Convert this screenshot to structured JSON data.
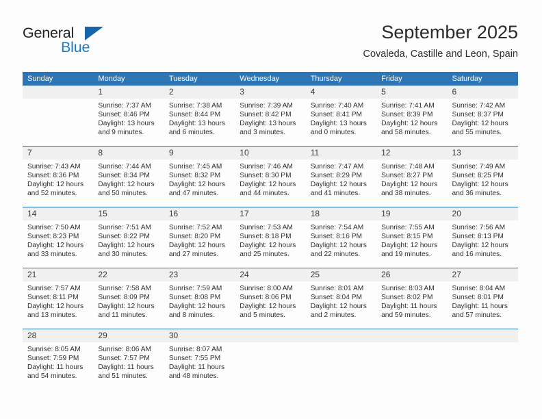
{
  "brand": {
    "name_part1": "General",
    "name_part2": "Blue",
    "logo_icon": "blue-triangle-logo",
    "accent_color": "#1a7bc4",
    "header_color": "#2e75b6"
  },
  "header": {
    "title": "September 2025",
    "subtitle": "Covaleda, Castille and Leon, Spain"
  },
  "calendar": {
    "weekdays": [
      "Sunday",
      "Monday",
      "Tuesday",
      "Wednesday",
      "Thursday",
      "Friday",
      "Saturday"
    ],
    "weeks": [
      [
        {
          "day": "",
          "empty": true
        },
        {
          "day": "1",
          "sunrise": "Sunrise: 7:37 AM",
          "sunset": "Sunset: 8:46 PM",
          "daylight1": "Daylight: 13 hours",
          "daylight2": "and 9 minutes."
        },
        {
          "day": "2",
          "sunrise": "Sunrise: 7:38 AM",
          "sunset": "Sunset: 8:44 PM",
          "daylight1": "Daylight: 13 hours",
          "daylight2": "and 6 minutes."
        },
        {
          "day": "3",
          "sunrise": "Sunrise: 7:39 AM",
          "sunset": "Sunset: 8:42 PM",
          "daylight1": "Daylight: 13 hours",
          "daylight2": "and 3 minutes."
        },
        {
          "day": "4",
          "sunrise": "Sunrise: 7:40 AM",
          "sunset": "Sunset: 8:41 PM",
          "daylight1": "Daylight: 13 hours",
          "daylight2": "and 0 minutes."
        },
        {
          "day": "5",
          "sunrise": "Sunrise: 7:41 AM",
          "sunset": "Sunset: 8:39 PM",
          "daylight1": "Daylight: 12 hours",
          "daylight2": "and 58 minutes."
        },
        {
          "day": "6",
          "sunrise": "Sunrise: 7:42 AM",
          "sunset": "Sunset: 8:37 PM",
          "daylight1": "Daylight: 12 hours",
          "daylight2": "and 55 minutes."
        }
      ],
      [
        {
          "day": "7",
          "sunrise": "Sunrise: 7:43 AM",
          "sunset": "Sunset: 8:36 PM",
          "daylight1": "Daylight: 12 hours",
          "daylight2": "and 52 minutes."
        },
        {
          "day": "8",
          "sunrise": "Sunrise: 7:44 AM",
          "sunset": "Sunset: 8:34 PM",
          "daylight1": "Daylight: 12 hours",
          "daylight2": "and 50 minutes."
        },
        {
          "day": "9",
          "sunrise": "Sunrise: 7:45 AM",
          "sunset": "Sunset: 8:32 PM",
          "daylight1": "Daylight: 12 hours",
          "daylight2": "and 47 minutes."
        },
        {
          "day": "10",
          "sunrise": "Sunrise: 7:46 AM",
          "sunset": "Sunset: 8:30 PM",
          "daylight1": "Daylight: 12 hours",
          "daylight2": "and 44 minutes."
        },
        {
          "day": "11",
          "sunrise": "Sunrise: 7:47 AM",
          "sunset": "Sunset: 8:29 PM",
          "daylight1": "Daylight: 12 hours",
          "daylight2": "and 41 minutes."
        },
        {
          "day": "12",
          "sunrise": "Sunrise: 7:48 AM",
          "sunset": "Sunset: 8:27 PM",
          "daylight1": "Daylight: 12 hours",
          "daylight2": "and 38 minutes."
        },
        {
          "day": "13",
          "sunrise": "Sunrise: 7:49 AM",
          "sunset": "Sunset: 8:25 PM",
          "daylight1": "Daylight: 12 hours",
          "daylight2": "and 36 minutes."
        }
      ],
      [
        {
          "day": "14",
          "sunrise": "Sunrise: 7:50 AM",
          "sunset": "Sunset: 8:23 PM",
          "daylight1": "Daylight: 12 hours",
          "daylight2": "and 33 minutes."
        },
        {
          "day": "15",
          "sunrise": "Sunrise: 7:51 AM",
          "sunset": "Sunset: 8:22 PM",
          "daylight1": "Daylight: 12 hours",
          "daylight2": "and 30 minutes."
        },
        {
          "day": "16",
          "sunrise": "Sunrise: 7:52 AM",
          "sunset": "Sunset: 8:20 PM",
          "daylight1": "Daylight: 12 hours",
          "daylight2": "and 27 minutes."
        },
        {
          "day": "17",
          "sunrise": "Sunrise: 7:53 AM",
          "sunset": "Sunset: 8:18 PM",
          "daylight1": "Daylight: 12 hours",
          "daylight2": "and 25 minutes."
        },
        {
          "day": "18",
          "sunrise": "Sunrise: 7:54 AM",
          "sunset": "Sunset: 8:16 PM",
          "daylight1": "Daylight: 12 hours",
          "daylight2": "and 22 minutes."
        },
        {
          "day": "19",
          "sunrise": "Sunrise: 7:55 AM",
          "sunset": "Sunset: 8:15 PM",
          "daylight1": "Daylight: 12 hours",
          "daylight2": "and 19 minutes."
        },
        {
          "day": "20",
          "sunrise": "Sunrise: 7:56 AM",
          "sunset": "Sunset: 8:13 PM",
          "daylight1": "Daylight: 12 hours",
          "daylight2": "and 16 minutes."
        }
      ],
      [
        {
          "day": "21",
          "sunrise": "Sunrise: 7:57 AM",
          "sunset": "Sunset: 8:11 PM",
          "daylight1": "Daylight: 12 hours",
          "daylight2": "and 13 minutes."
        },
        {
          "day": "22",
          "sunrise": "Sunrise: 7:58 AM",
          "sunset": "Sunset: 8:09 PM",
          "daylight1": "Daylight: 12 hours",
          "daylight2": "and 11 minutes."
        },
        {
          "day": "23",
          "sunrise": "Sunrise: 7:59 AM",
          "sunset": "Sunset: 8:08 PM",
          "daylight1": "Daylight: 12 hours",
          "daylight2": "and 8 minutes."
        },
        {
          "day": "24",
          "sunrise": "Sunrise: 8:00 AM",
          "sunset": "Sunset: 8:06 PM",
          "daylight1": "Daylight: 12 hours",
          "daylight2": "and 5 minutes."
        },
        {
          "day": "25",
          "sunrise": "Sunrise: 8:01 AM",
          "sunset": "Sunset: 8:04 PM",
          "daylight1": "Daylight: 12 hours",
          "daylight2": "and 2 minutes."
        },
        {
          "day": "26",
          "sunrise": "Sunrise: 8:03 AM",
          "sunset": "Sunset: 8:02 PM",
          "daylight1": "Daylight: 11 hours",
          "daylight2": "and 59 minutes."
        },
        {
          "day": "27",
          "sunrise": "Sunrise: 8:04 AM",
          "sunset": "Sunset: 8:01 PM",
          "daylight1": "Daylight: 11 hours",
          "daylight2": "and 57 minutes."
        }
      ],
      [
        {
          "day": "28",
          "sunrise": "Sunrise: 8:05 AM",
          "sunset": "Sunset: 7:59 PM",
          "daylight1": "Daylight: 11 hours",
          "daylight2": "and 54 minutes."
        },
        {
          "day": "29",
          "sunrise": "Sunrise: 8:06 AM",
          "sunset": "Sunset: 7:57 PM",
          "daylight1": "Daylight: 11 hours",
          "daylight2": "and 51 minutes."
        },
        {
          "day": "30",
          "sunrise": "Sunrise: 8:07 AM",
          "sunset": "Sunset: 7:55 PM",
          "daylight1": "Daylight: 11 hours",
          "daylight2": "and 48 minutes."
        },
        {
          "day": "",
          "empty": true
        },
        {
          "day": "",
          "empty": true
        },
        {
          "day": "",
          "empty": true
        },
        {
          "day": "",
          "empty": true
        }
      ]
    ]
  }
}
